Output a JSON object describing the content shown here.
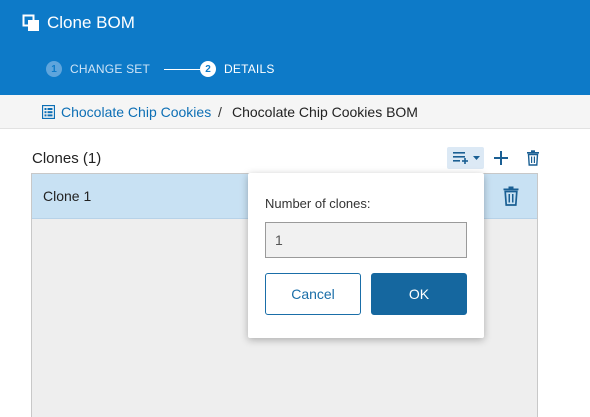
{
  "header": {
    "title": "Clone BOM",
    "icon": "clone-icon",
    "color": "#0d7ac8"
  },
  "stepper": {
    "steps": [
      {
        "number": "1",
        "label": "CHANGE SET",
        "state": "done"
      },
      {
        "number": "2",
        "label": "DETAILS",
        "state": "active"
      }
    ]
  },
  "breadcrumb": {
    "icon": "list-icon",
    "parent": "Chocolate Chip Cookies",
    "separator": "/",
    "current": "Chocolate Chip Cookies BOM"
  },
  "clones": {
    "title": "Clones (1)",
    "toolbar": {
      "icons": [
        "add-multiple-icon",
        "chevron-down-icon",
        "plus-icon",
        "trash-icon"
      ]
    },
    "items": [
      {
        "label": "Clone 1",
        "selected": true
      }
    ]
  },
  "popover": {
    "label": "Number of clones:",
    "value": "1",
    "cancel_label": "Cancel",
    "ok_label": "OK",
    "accent": "#15679f"
  }
}
